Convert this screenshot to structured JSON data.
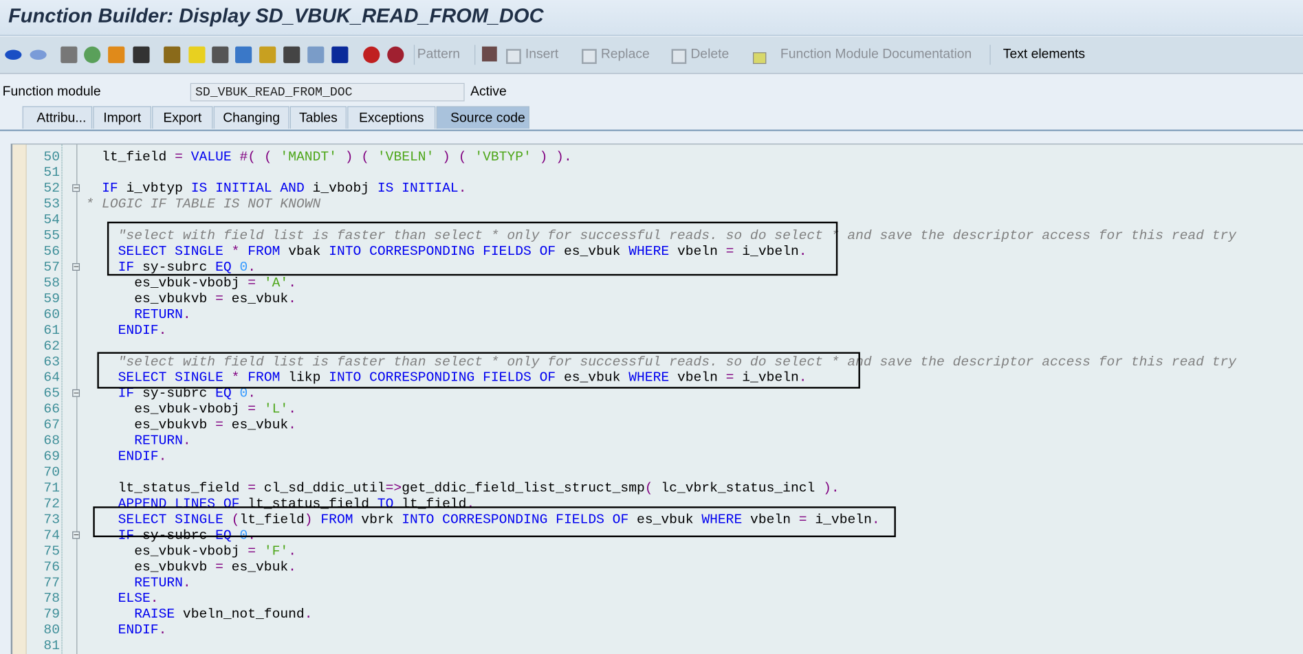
{
  "window": {
    "title": "Function Builder: Display SD_VBUK_READ_FROM_DOC"
  },
  "toolbar": {
    "icons": [
      "back-arrow-icon",
      "forward-arrow-icon",
      "display-change-icon",
      "active-inactive-icon",
      "other-object-icon",
      "where-used-icon",
      "check-icon",
      "activate-icon",
      "test-icon",
      "navigation-icon",
      "hierarchy-icon",
      "stack-icon",
      "object-list-icon",
      "info-icon",
      "set-breakpoint-icon",
      "set-user-breakpoint-icon"
    ],
    "pattern": "Pattern",
    "insert": "Insert",
    "replace": "Replace",
    "delete": "Delete",
    "documentation": "Function Module Documentation",
    "text_elements": "Text elements"
  },
  "header": {
    "label": "Function module",
    "value": "SD_VBUK_READ_FROM_DOC",
    "status": "Active"
  },
  "tabs": [
    {
      "label": "Attribu..."
    },
    {
      "label": "Import"
    },
    {
      "label": "Export"
    },
    {
      "label": "Changing"
    },
    {
      "label": "Tables"
    },
    {
      "label": "Exceptions"
    },
    {
      "label": "Source code",
      "selected": true
    }
  ],
  "colors": {
    "keyword": "#0000f0",
    "string": "#4da619",
    "comment": "#808080",
    "operator": "#800080",
    "number": "#3399ff",
    "line_number": "#3f8f99"
  },
  "code": [
    {
      "n": "50",
      "t": [
        [
          "",
          "  lt_field "
        ],
        [
          "p",
          "="
        ],
        [
          "",
          " "
        ],
        [
          "k",
          "VALUE"
        ],
        [
          "",
          " "
        ],
        [
          "p",
          "#( ( "
        ],
        [
          "s",
          "'MANDT'"
        ],
        [
          "p",
          " ) ( "
        ],
        [
          "s",
          "'VBELN'"
        ],
        [
          "p",
          " ) ( "
        ],
        [
          "s",
          "'VBTYP'"
        ],
        [
          "p",
          " ) )."
        ]
      ]
    },
    {
      "n": "51",
      "t": []
    },
    {
      "n": "52",
      "fold": "open",
      "t": [
        [
          "",
          "  "
        ],
        [
          "k",
          "IF"
        ],
        [
          "",
          " i_vbtyp "
        ],
        [
          "k",
          "IS INITIAL AND"
        ],
        [
          "",
          " i_vbobj "
        ],
        [
          "k",
          "IS INITIAL"
        ],
        [
          "p",
          "."
        ]
      ]
    },
    {
      "n": "53",
      "t": [
        [
          "c",
          "* LOGIC IF TABLE IS NOT KNOWN"
        ]
      ]
    },
    {
      "n": "54",
      "t": []
    },
    {
      "n": "55",
      "t": [
        [
          "",
          "    "
        ],
        [
          "c",
          "\"select with field list is faster than select * only for successful reads. so do select * and save the descriptor access for this read try"
        ]
      ]
    },
    {
      "n": "56",
      "t": [
        [
          "",
          "    "
        ],
        [
          "k",
          "SELECT SINGLE"
        ],
        [
          "",
          " "
        ],
        [
          "p",
          "*"
        ],
        [
          "",
          " "
        ],
        [
          "k",
          "FROM"
        ],
        [
          "",
          " vbak "
        ],
        [
          "k",
          "INTO CORRESPONDING FIELDS OF"
        ],
        [
          "",
          " es_vbuk "
        ],
        [
          "k",
          "WHERE"
        ],
        [
          "",
          " vbeln "
        ],
        [
          "p",
          "="
        ],
        [
          "",
          " i_vbeln"
        ],
        [
          "p",
          "."
        ]
      ]
    },
    {
      "n": "57",
      "fold": "open",
      "t": [
        [
          "",
          "    "
        ],
        [
          "k",
          "IF"
        ],
        [
          "",
          " sy-subrc "
        ],
        [
          "k",
          "EQ"
        ],
        [
          "",
          " "
        ],
        [
          "n",
          "0"
        ],
        [
          "p",
          "."
        ]
      ]
    },
    {
      "n": "58",
      "t": [
        [
          "",
          "      es_vbuk-vbobj "
        ],
        [
          "p",
          "="
        ],
        [
          "",
          " "
        ],
        [
          "s",
          "'A'"
        ],
        [
          "p",
          "."
        ]
      ]
    },
    {
      "n": "59",
      "t": [
        [
          "",
          "      es_vbukvb "
        ],
        [
          "p",
          "="
        ],
        [
          "",
          " es_vbuk"
        ],
        [
          "p",
          "."
        ]
      ]
    },
    {
      "n": "60",
      "t": [
        [
          "",
          "      "
        ],
        [
          "k",
          "RETURN"
        ],
        [
          "p",
          "."
        ]
      ]
    },
    {
      "n": "61",
      "t": [
        [
          "",
          "    "
        ],
        [
          "k",
          "ENDIF"
        ],
        [
          "p",
          "."
        ]
      ]
    },
    {
      "n": "62",
      "t": []
    },
    {
      "n": "63",
      "t": [
        [
          "",
          "    "
        ],
        [
          "c",
          "\"select with field list is faster than select * only for successful reads. so do select * and save the descriptor access for this read try"
        ]
      ]
    },
    {
      "n": "64",
      "t": [
        [
          "",
          "    "
        ],
        [
          "k",
          "SELECT SINGLE"
        ],
        [
          "",
          " "
        ],
        [
          "p",
          "*"
        ],
        [
          "",
          " "
        ],
        [
          "k",
          "FROM"
        ],
        [
          "",
          " likp "
        ],
        [
          "k",
          "INTO CORRESPONDING FIELDS OF"
        ],
        [
          "",
          " es_vbuk "
        ],
        [
          "k",
          "WHERE"
        ],
        [
          "",
          " vbeln "
        ],
        [
          "p",
          "="
        ],
        [
          "",
          " i_vbeln"
        ],
        [
          "p",
          "."
        ]
      ]
    },
    {
      "n": "65",
      "fold": "open",
      "t": [
        [
          "",
          "    "
        ],
        [
          "k",
          "IF"
        ],
        [
          "",
          " sy-subrc "
        ],
        [
          "k",
          "EQ"
        ],
        [
          "",
          " "
        ],
        [
          "n",
          "0"
        ],
        [
          "p",
          "."
        ]
      ]
    },
    {
      "n": "66",
      "t": [
        [
          "",
          "      es_vbuk-vbobj "
        ],
        [
          "p",
          "="
        ],
        [
          "",
          " "
        ],
        [
          "s",
          "'L'"
        ],
        [
          "p",
          "."
        ]
      ]
    },
    {
      "n": "67",
      "t": [
        [
          "",
          "      es_vbukvb "
        ],
        [
          "p",
          "="
        ],
        [
          "",
          " es_vbuk"
        ],
        [
          "p",
          "."
        ]
      ]
    },
    {
      "n": "68",
      "t": [
        [
          "",
          "      "
        ],
        [
          "k",
          "RETURN"
        ],
        [
          "p",
          "."
        ]
      ]
    },
    {
      "n": "69",
      "t": [
        [
          "",
          "    "
        ],
        [
          "k",
          "ENDIF"
        ],
        [
          "p",
          "."
        ]
      ]
    },
    {
      "n": "70",
      "t": []
    },
    {
      "n": "71",
      "t": [
        [
          "",
          "    lt_status_field "
        ],
        [
          "p",
          "="
        ],
        [
          "",
          " cl_sd_ddic_util"
        ],
        [
          "p",
          "=>"
        ],
        [
          "",
          "get_ddic_field_list_struct_smp"
        ],
        [
          "p",
          "("
        ],
        [
          "",
          " lc_vbrk_status_incl "
        ],
        [
          "p",
          ")."
        ]
      ]
    },
    {
      "n": "72",
      "t": [
        [
          "",
          "    "
        ],
        [
          "k",
          "APPEND LINES OF"
        ],
        [
          "",
          " lt_status_field "
        ],
        [
          "k",
          "TO"
        ],
        [
          "",
          " lt_field"
        ],
        [
          "p",
          "."
        ]
      ]
    },
    {
      "n": "73",
      "t": [
        [
          "",
          "    "
        ],
        [
          "k",
          "SELECT SINGLE"
        ],
        [
          "",
          " "
        ],
        [
          "p",
          "("
        ],
        [
          "",
          "lt_field"
        ],
        [
          "p",
          ")"
        ],
        [
          "",
          " "
        ],
        [
          "k",
          "FROM"
        ],
        [
          "",
          " vbrk "
        ],
        [
          "k",
          "INTO CORRESPONDING FIELDS OF"
        ],
        [
          "",
          " es_vbuk "
        ],
        [
          "k",
          "WHERE"
        ],
        [
          "",
          " vbeln "
        ],
        [
          "p",
          "="
        ],
        [
          "",
          " i_vbeln"
        ],
        [
          "p",
          "."
        ]
      ]
    },
    {
      "n": "74",
      "fold": "open",
      "t": [
        [
          "",
          "    "
        ],
        [
          "k",
          "IF"
        ],
        [
          "",
          " sy-subrc "
        ],
        [
          "k",
          "EQ"
        ],
        [
          "",
          " "
        ],
        [
          "n",
          "0"
        ],
        [
          "p",
          "."
        ]
      ]
    },
    {
      "n": "75",
      "t": [
        [
          "",
          "      es_vbuk-vbobj "
        ],
        [
          "p",
          "="
        ],
        [
          "",
          " "
        ],
        [
          "s",
          "'F'"
        ],
        [
          "p",
          "."
        ]
      ]
    },
    {
      "n": "76",
      "t": [
        [
          "",
          "      es_vbukvb "
        ],
        [
          "p",
          "="
        ],
        [
          "",
          " es_vbuk"
        ],
        [
          "p",
          "."
        ]
      ]
    },
    {
      "n": "77",
      "t": [
        [
          "",
          "      "
        ],
        [
          "k",
          "RETURN"
        ],
        [
          "p",
          "."
        ]
      ]
    },
    {
      "n": "78",
      "t": [
        [
          "",
          "    "
        ],
        [
          "k",
          "ELSE"
        ],
        [
          "p",
          "."
        ]
      ]
    },
    {
      "n": "79",
      "t": [
        [
          "",
          "      "
        ],
        [
          "k",
          "RAISE"
        ],
        [
          "",
          " vbeln_not_found"
        ],
        [
          "p",
          "."
        ]
      ]
    },
    {
      "n": "80",
      "t": [
        [
          "",
          "    "
        ],
        [
          "k",
          "ENDIF"
        ],
        [
          "p",
          "."
        ]
      ]
    },
    {
      "n": "81",
      "t": []
    }
  ]
}
